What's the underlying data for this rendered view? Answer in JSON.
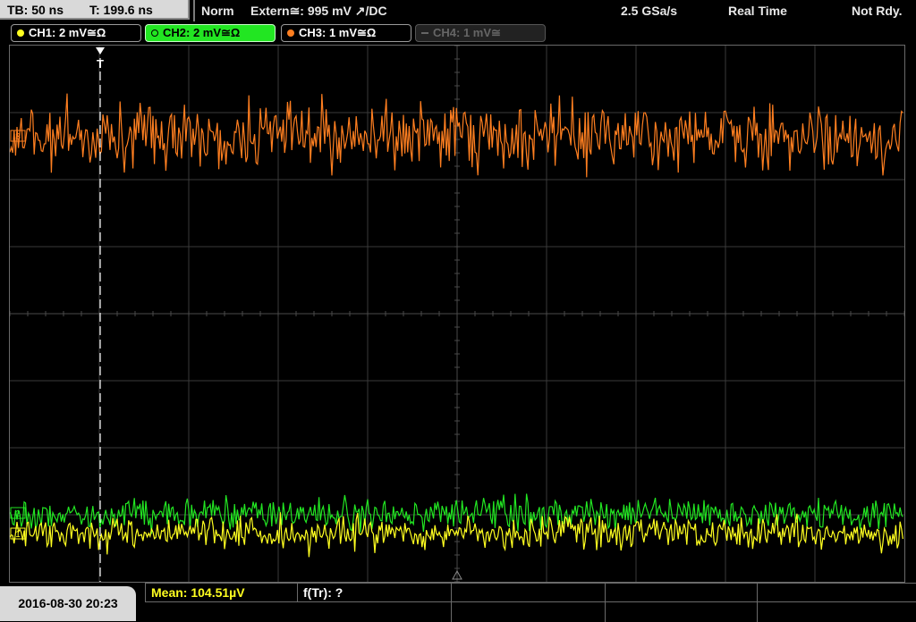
{
  "top": {
    "timebase": "TB: 50 ns",
    "trigger_time": "T: 199.6 ns",
    "trigger_mode": "Norm",
    "trigger_source": "Extern≅: 995 mV ↗/DC",
    "sample_rate": "2.5 GSa/s",
    "acq_mode": "Real Time",
    "status": "Not Rdy."
  },
  "channels": [
    {
      "label": "CH1: 2 mV≅Ω",
      "color": "#ffff20"
    },
    {
      "label": "CH2: 2 mV≅Ω",
      "color": "#22e622"
    },
    {
      "label": "CH3: 1 mV≅Ω",
      "color": "#ff7f20"
    },
    {
      "label": "CH4: 1 mV≅",
      "color": "#666666"
    }
  ],
  "trigger_marker": "T",
  "bottom": {
    "datetime": "2016-08-30 20:23",
    "mean": "Mean: 104.51µV",
    "f_tr": "f(Tr): ?"
  },
  "markers": {
    "ch1": "1",
    "ch2": "2",
    "ch3": "3"
  }
}
